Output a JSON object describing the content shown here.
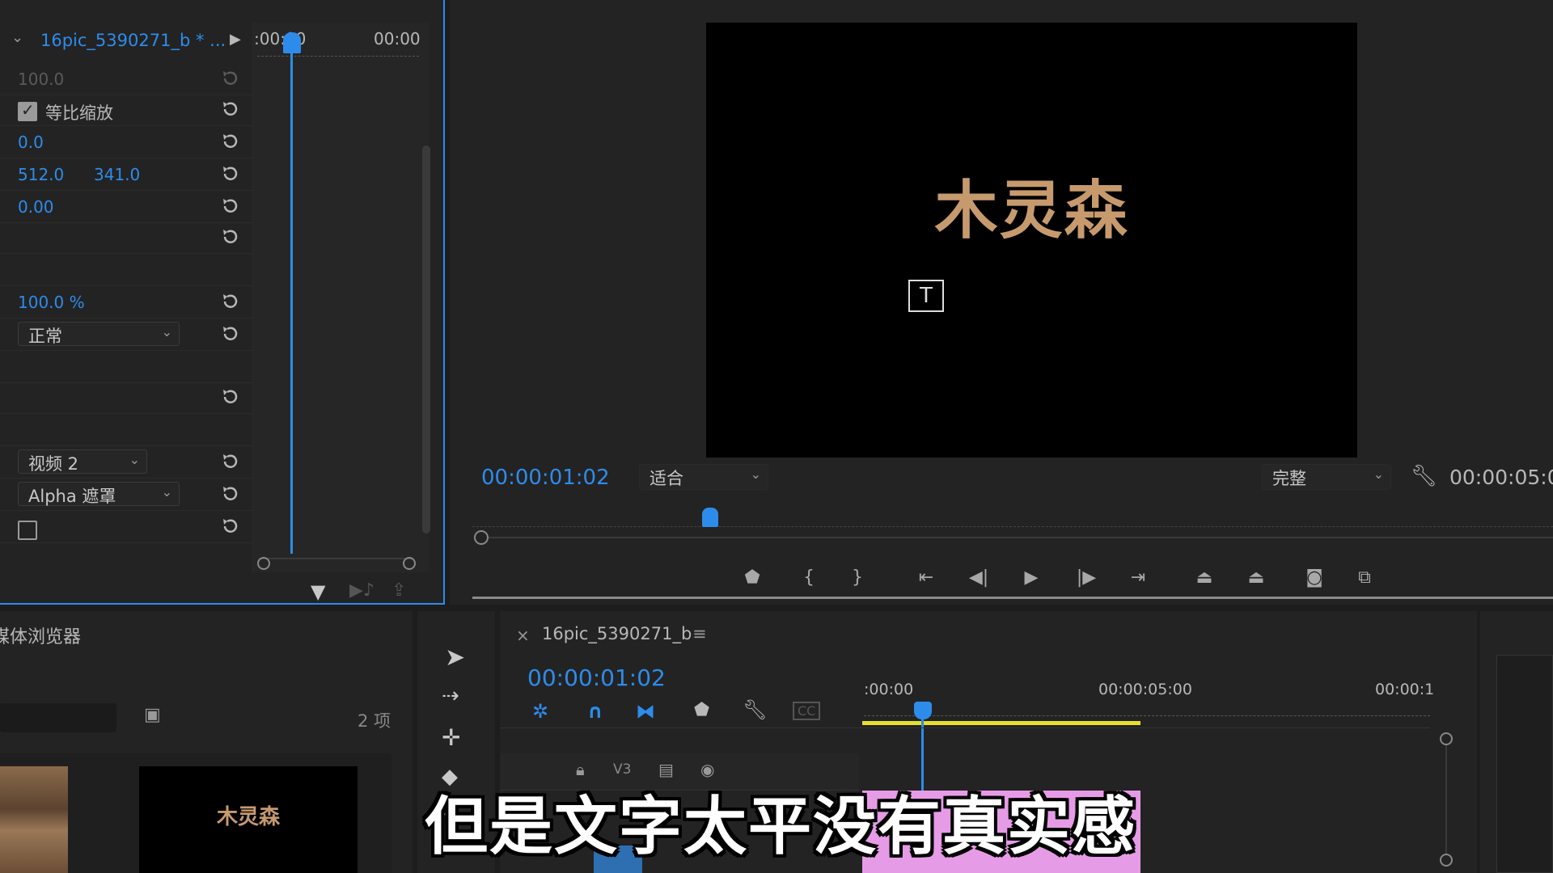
{
  "effect_controls": {
    "clip_name": "16pic_5390271_b * ...",
    "timecode_start": ":00:00",
    "timecode_end": "00:00",
    "rows": {
      "scale_width": "100.0",
      "uniform_scale_label": "等比缩放",
      "rotation": "0.0",
      "anchor_x": "512.0",
      "anchor_y": "341.0",
      "antiflicker": "0.00",
      "opacity": "100.0 %",
      "blend_mode": "正常",
      "track_source": "视频 2",
      "matte_type": "Alpha 遮罩"
    }
  },
  "program_monitor": {
    "title_text": "木灵森",
    "timecode": "00:00:01:02",
    "fit_label": "适合",
    "quality_label": "完整",
    "duration": "00:00:05:0"
  },
  "media_browser": {
    "title": "媒体浏览器",
    "item_count": "2 项",
    "thumbnail_text": "木灵森"
  },
  "timeline": {
    "sequence_name": "16pic_5390271_b",
    "timecode": "00:00:01:02",
    "ruler": [
      ":00:00",
      "00:00:05:00",
      "00:00:1"
    ],
    "track_v3": "V3"
  },
  "subtitle": "但是文字太平没有真实感",
  "colors": {
    "accent": "#2d8ceb",
    "panel": "#232323",
    "title_gold": "#c79a6e",
    "work_area": "#e6e02e",
    "clip_pink": "#e69be6"
  }
}
